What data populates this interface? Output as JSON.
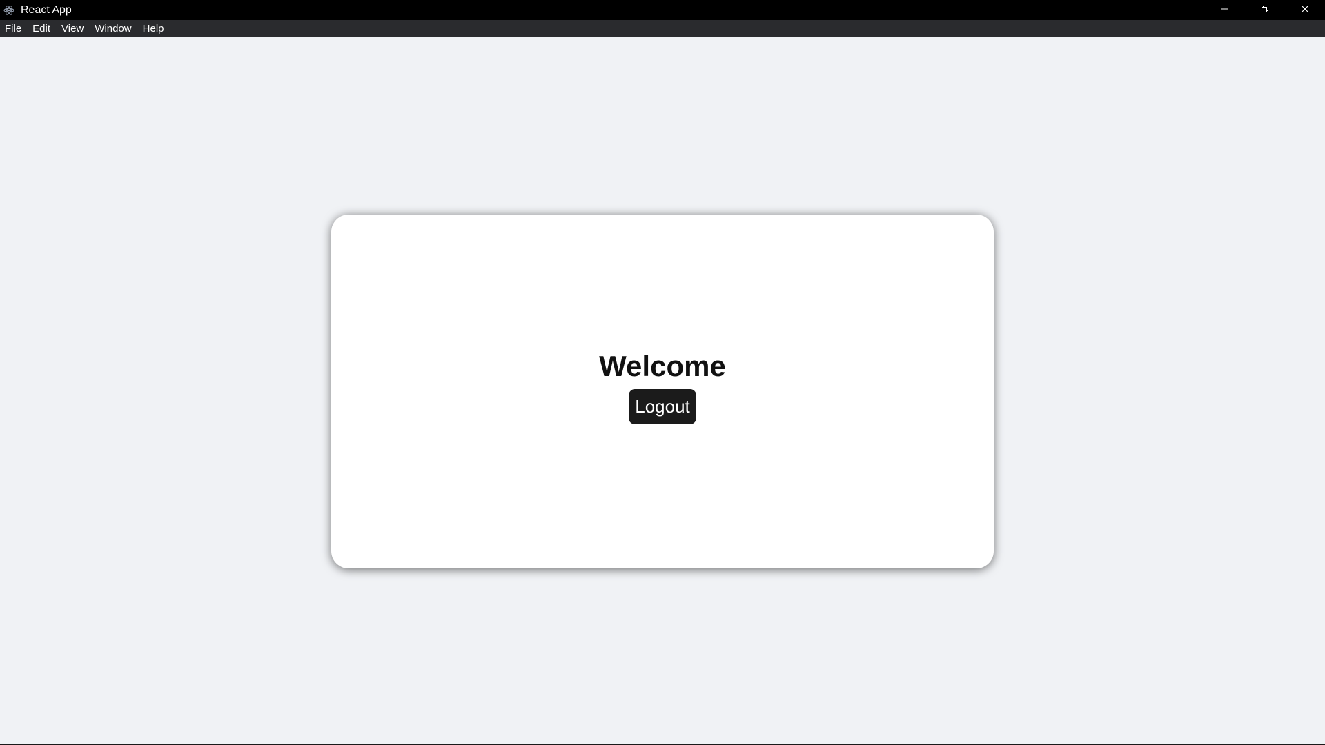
{
  "window": {
    "title": "React App",
    "icon": "electron-icon",
    "controls": [
      "minimize-icon",
      "restore-icon",
      "close-icon"
    ]
  },
  "menu": {
    "items": [
      "File",
      "Edit",
      "View",
      "Window",
      "Help"
    ]
  },
  "card": {
    "heading": "Welcome",
    "logout_label": "Logout"
  },
  "colors": {
    "titlebar": "#000000",
    "menubar": "#2a2b2e",
    "background": "#f0f2f5",
    "card": "#ffffff",
    "button": "#1b1b1b"
  }
}
